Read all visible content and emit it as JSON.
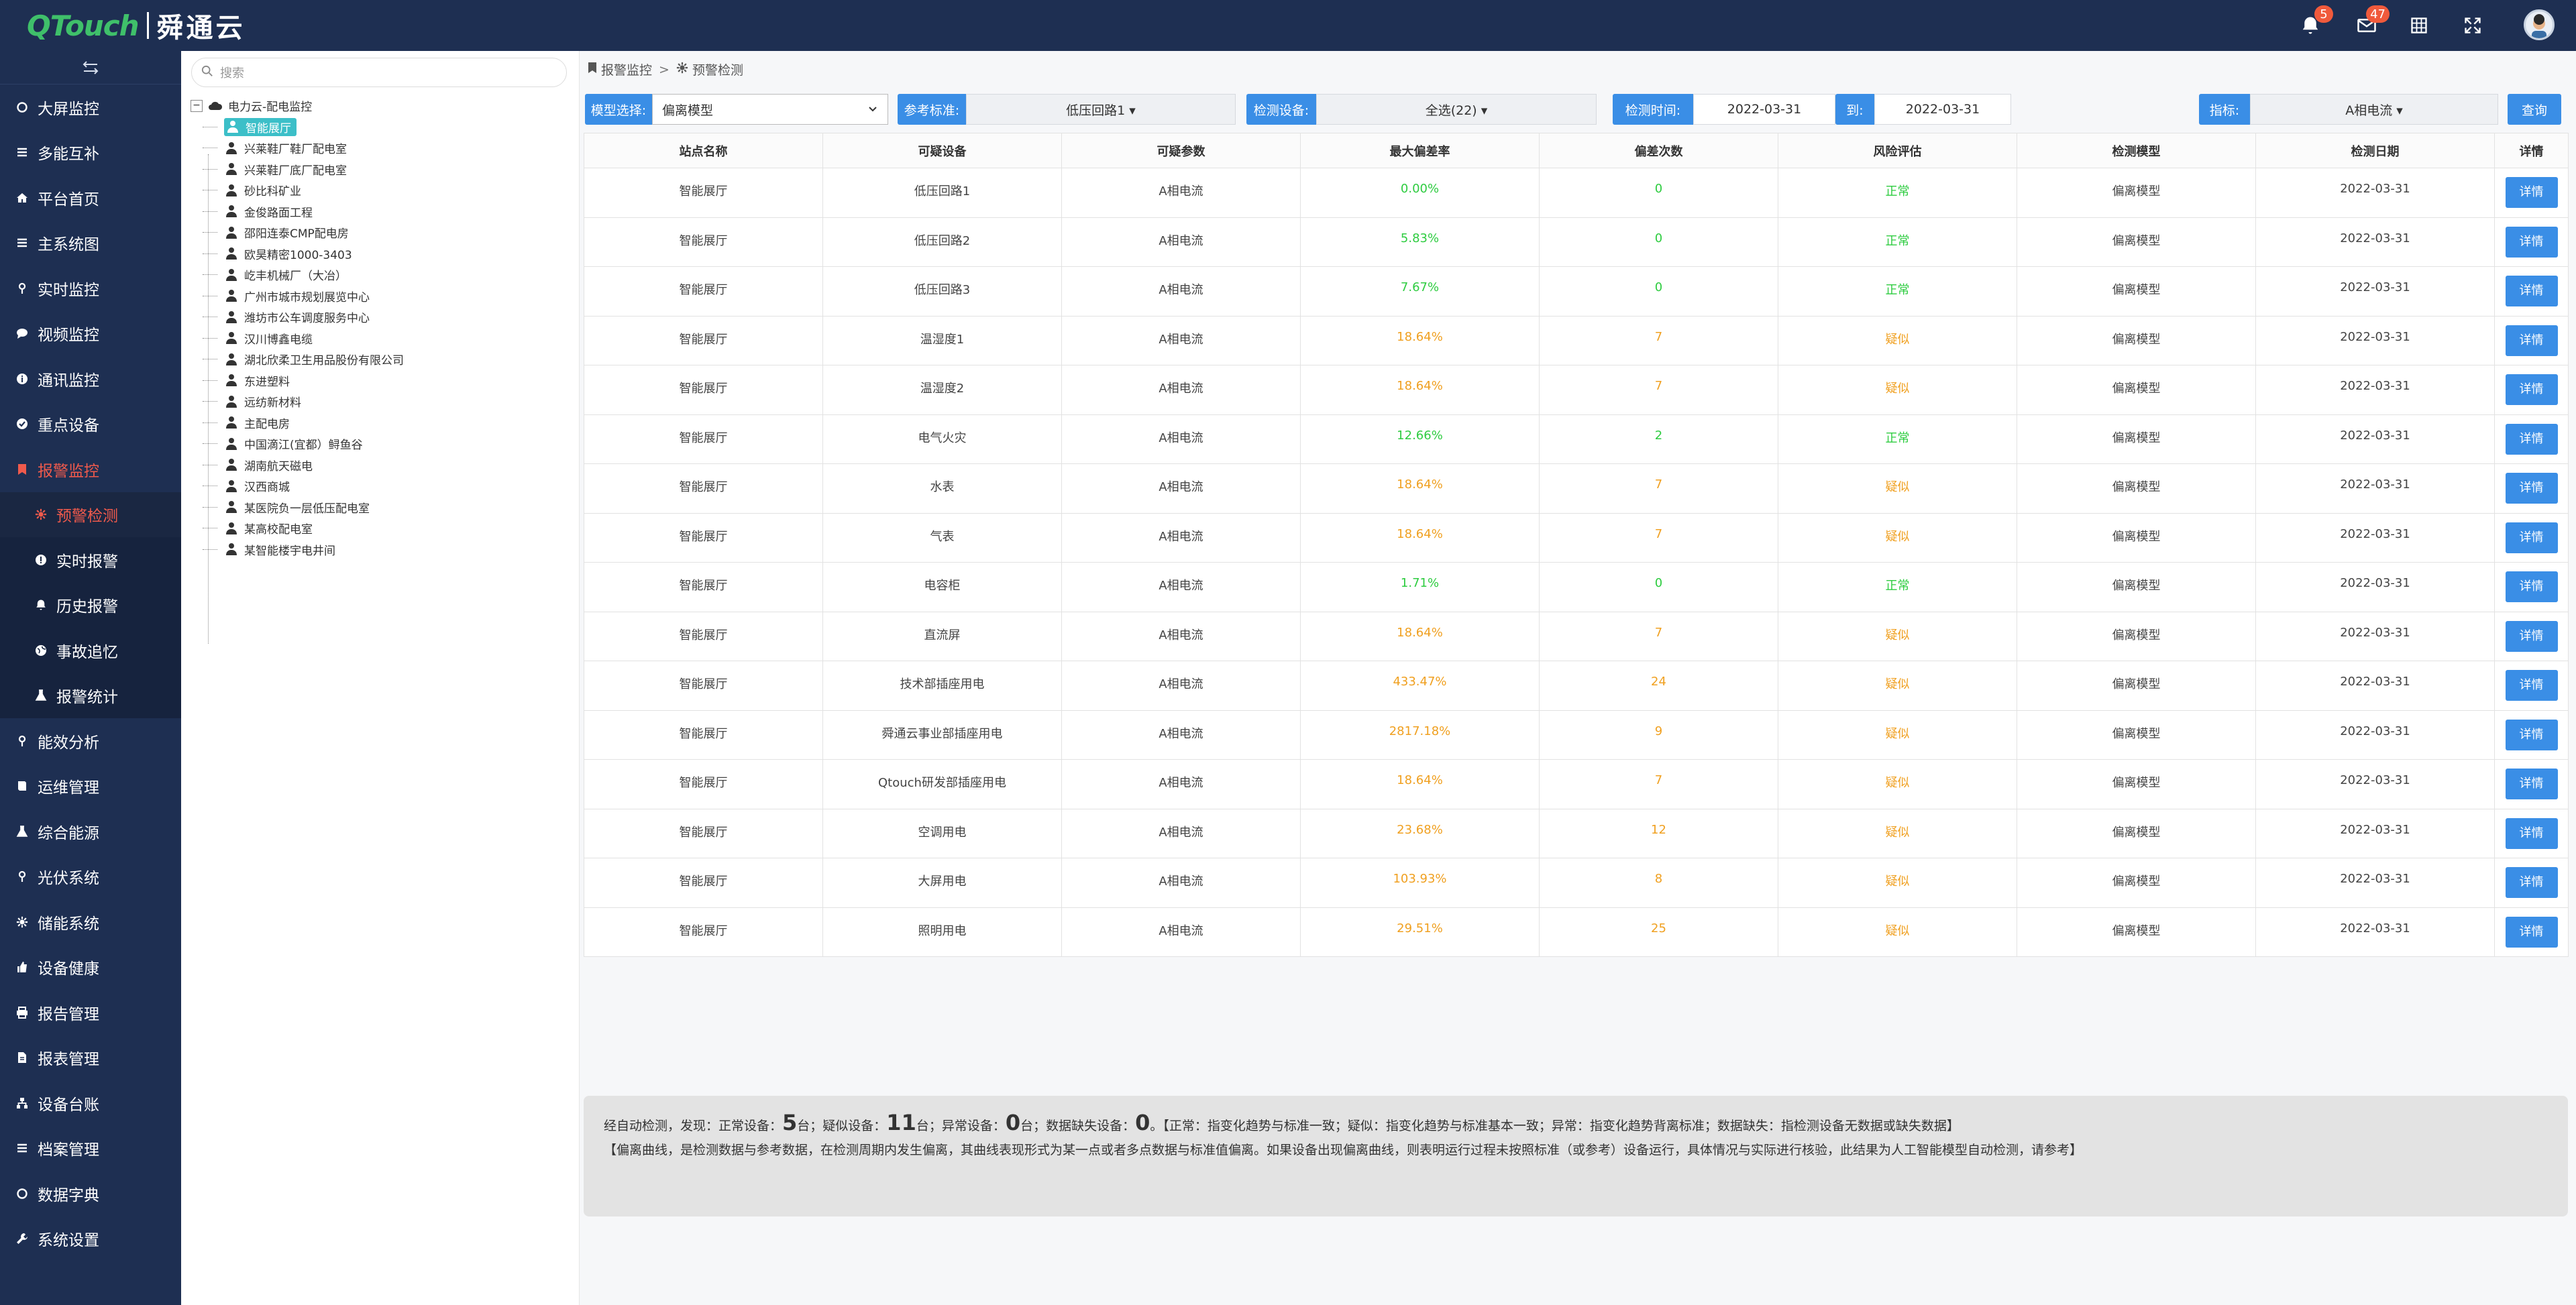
{
  "header": {
    "logo_en": "QTouch",
    "logo_cn": "舜通云",
    "notifications_count": "5",
    "messages_count": "47",
    "icons": [
      "bell-icon",
      "envelope-icon",
      "grid-icon",
      "fullscreen-icon"
    ]
  },
  "sidebar": {
    "toggle_icon": "menu-toggle-icon",
    "items": [
      {
        "label": "大屏监控",
        "icon": "circle-icon"
      },
      {
        "label": "多能互补",
        "icon": "list-icon"
      },
      {
        "label": "平台首页",
        "icon": "home-icon"
      },
      {
        "label": "主系统图",
        "icon": "list-icon"
      },
      {
        "label": "实时监控",
        "icon": "pin-icon"
      },
      {
        "label": "视频监控",
        "icon": "chat-icon"
      },
      {
        "label": "通讯监控",
        "icon": "info-icon"
      },
      {
        "label": "重点设备",
        "icon": "check-icon"
      },
      {
        "label": "报警监控",
        "icon": "bookmark-icon",
        "active": true
      }
    ],
    "subitems": [
      {
        "label": "预警检测",
        "icon": "gear-icon",
        "current": true
      },
      {
        "label": "实时报警",
        "icon": "alert-icon"
      },
      {
        "label": "历史报警",
        "icon": "bell-icon"
      },
      {
        "label": "事故追忆",
        "icon": "globe-icon"
      },
      {
        "label": "报警统计",
        "icon": "flask-icon"
      }
    ],
    "items_after": [
      {
        "label": "能效分析",
        "icon": "pin-icon"
      },
      {
        "label": "运维管理",
        "icon": "book-icon"
      },
      {
        "label": "综合能源",
        "icon": "flask-icon"
      },
      {
        "label": "光伏系统",
        "icon": "pin-icon"
      },
      {
        "label": "储能系统",
        "icon": "gear-icon"
      },
      {
        "label": "设备健康",
        "icon": "thumb-icon"
      },
      {
        "label": "报告管理",
        "icon": "print-icon"
      },
      {
        "label": "报表管理",
        "icon": "file-icon"
      },
      {
        "label": "设备台账",
        "icon": "sitemap-icon"
      },
      {
        "label": "档案管理",
        "icon": "list-icon"
      },
      {
        "label": "数据字典",
        "icon": "circle-icon"
      },
      {
        "label": "系统设置",
        "icon": "wrench-icon"
      }
    ]
  },
  "tree": {
    "search_placeholder": "搜索",
    "root": "电力云-配电监控",
    "root_toggle": "−",
    "children": [
      "智能展厅",
      "兴莱鞋厂鞋厂配电室",
      "兴莱鞋厂底厂配电室",
      "砂比科矿业",
      "金俊路面工程",
      "邵阳连泰CMP配电房",
      "欧昊精密1000-3403",
      "屹丰机械厂（大冶）",
      "广州市城市规划展览中心",
      "潍坊市公车调度服务中心",
      "汉川博鑫电缆",
      "湖北欣柔卫生用品股份有限公司",
      "东进塑料",
      "远纺新材料",
      "主配电房",
      "中国滴江(宜都）鲟鱼谷",
      "湖南航天磁电",
      "汉西商城",
      "某医院负一层低压配电室",
      "某高校配电室",
      "某智能楼宇电井间"
    ],
    "selected": "智能展厅"
  },
  "breadcrumb": {
    "parent": "报警监控",
    "current": "预警检测",
    "separator": ">"
  },
  "filters": {
    "model_label": "模型选择:",
    "model_value": "偏离模型",
    "reference_label": "参考标准:",
    "reference_value": "低压回路1 ▾",
    "device_label": "检测设备:",
    "device_value": "全选(22) ▾",
    "time_label": "检测时间:",
    "time_from": "2022-03-31",
    "to_label": "到:",
    "time_to": "2022-03-31",
    "indicator_label": "指标:",
    "indicator_value": "A相电流 ▾",
    "query_label": "查询"
  },
  "table": {
    "columns": [
      "站点名称",
      "可疑设备",
      "可疑参数",
      "最大偏差率",
      "偏差次数",
      "风险评估",
      "检测模型",
      "检测日期",
      "详情"
    ],
    "detail_label": "详情",
    "rows": [
      {
        "site": "智能展厅",
        "device": "低压回路1",
        "param": "A相电流",
        "rate": "0.00%",
        "count": "0",
        "risk": "正常",
        "model": "偏离模型",
        "date": "2022-03-31",
        "level": "normal"
      },
      {
        "site": "智能展厅",
        "device": "低压回路2",
        "param": "A相电流",
        "rate": "5.83%",
        "count": "0",
        "risk": "正常",
        "model": "偏离模型",
        "date": "2022-03-31",
        "level": "normal"
      },
      {
        "site": "智能展厅",
        "device": "低压回路3",
        "param": "A相电流",
        "rate": "7.67%",
        "count": "0",
        "risk": "正常",
        "model": "偏离模型",
        "date": "2022-03-31",
        "level": "normal"
      },
      {
        "site": "智能展厅",
        "device": "温湿度1",
        "param": "A相电流",
        "rate": "18.64%",
        "count": "7",
        "risk": "疑似",
        "model": "偏离模型",
        "date": "2022-03-31",
        "level": "warn"
      },
      {
        "site": "智能展厅",
        "device": "温湿度2",
        "param": "A相电流",
        "rate": "18.64%",
        "count": "7",
        "risk": "疑似",
        "model": "偏离模型",
        "date": "2022-03-31",
        "level": "warn"
      },
      {
        "site": "智能展厅",
        "device": "电气火灾",
        "param": "A相电流",
        "rate": "12.66%",
        "count": "2",
        "risk": "正常",
        "model": "偏离模型",
        "date": "2022-03-31",
        "level": "normal"
      },
      {
        "site": "智能展厅",
        "device": "水表",
        "param": "A相电流",
        "rate": "18.64%",
        "count": "7",
        "risk": "疑似",
        "model": "偏离模型",
        "date": "2022-03-31",
        "level": "warn"
      },
      {
        "site": "智能展厅",
        "device": "气表",
        "param": "A相电流",
        "rate": "18.64%",
        "count": "7",
        "risk": "疑似",
        "model": "偏离模型",
        "date": "2022-03-31",
        "level": "warn"
      },
      {
        "site": "智能展厅",
        "device": "电容柜",
        "param": "A相电流",
        "rate": "1.71%",
        "count": "0",
        "risk": "正常",
        "model": "偏离模型",
        "date": "2022-03-31",
        "level": "normal"
      },
      {
        "site": "智能展厅",
        "device": "直流屏",
        "param": "A相电流",
        "rate": "18.64%",
        "count": "7",
        "risk": "疑似",
        "model": "偏离模型",
        "date": "2022-03-31",
        "level": "warn"
      },
      {
        "site": "智能展厅",
        "device": "技术部插座用电",
        "param": "A相电流",
        "rate": "433.47%",
        "count": "24",
        "risk": "疑似",
        "model": "偏离模型",
        "date": "2022-03-31",
        "level": "warn"
      },
      {
        "site": "智能展厅",
        "device": "舜通云事业部插座用电",
        "param": "A相电流",
        "rate": "2817.18%",
        "count": "9",
        "risk": "疑似",
        "model": "偏离模型",
        "date": "2022-03-31",
        "level": "warn"
      },
      {
        "site": "智能展厅",
        "device": "Qtouch研发部插座用电",
        "param": "A相电流",
        "rate": "18.64%",
        "count": "7",
        "risk": "疑似",
        "model": "偏离模型",
        "date": "2022-03-31",
        "level": "warn"
      },
      {
        "site": "智能展厅",
        "device": "空调用电",
        "param": "A相电流",
        "rate": "23.68%",
        "count": "12",
        "risk": "疑似",
        "model": "偏离模型",
        "date": "2022-03-31",
        "level": "warn"
      },
      {
        "site": "智能展厅",
        "device": "大屏用电",
        "param": "A相电流",
        "rate": "103.93%",
        "count": "8",
        "risk": "疑似",
        "model": "偏离模型",
        "date": "2022-03-31",
        "level": "warn"
      },
      {
        "site": "智能展厅",
        "device": "照明用电",
        "param": "A相电流",
        "rate": "29.51%",
        "count": "25",
        "risk": "疑似",
        "model": "偏离模型",
        "date": "2022-03-31",
        "level": "warn"
      }
    ]
  },
  "summary": {
    "prefix": "经自动检测，发现：正常设备：",
    "normal_count": "5",
    "normal_unit": "台；疑似设备：",
    "suspect_count": "11",
    "suspect_unit": "台；异常设备：",
    "abnormal_count": "0",
    "abnormal_unit": "台；数据缺失设备：",
    "missing_count": "0",
    "legend": "。【正常：指变化趋势与标准一致；疑似：指变化趋势与标准基本一致；异常：指变化趋势背离标准；数据缺失：指检测设备无数据或缺失数据】",
    "note": "【偏离曲线，是检测数据与参考数据，在检测周期内发生偏离，其曲线表现形式为某一点或者多点数据与标准值偏离。如果设备出现偏离曲线，则表明运行过程未按照标准（或参考）设备运行，具体情况与实际进行核验，此结果为人工智能模型自动检测，请参考】"
  },
  "colors": {
    "header_bg": "#1e2f52",
    "sidebar_bg": "#1e2f52",
    "accent": "#3a8ee6",
    "active_red": "#f05a4c",
    "normal_green": "#2ecc40",
    "warn_orange": "#f0a020",
    "selected_tree": "#3cbfc8"
  }
}
